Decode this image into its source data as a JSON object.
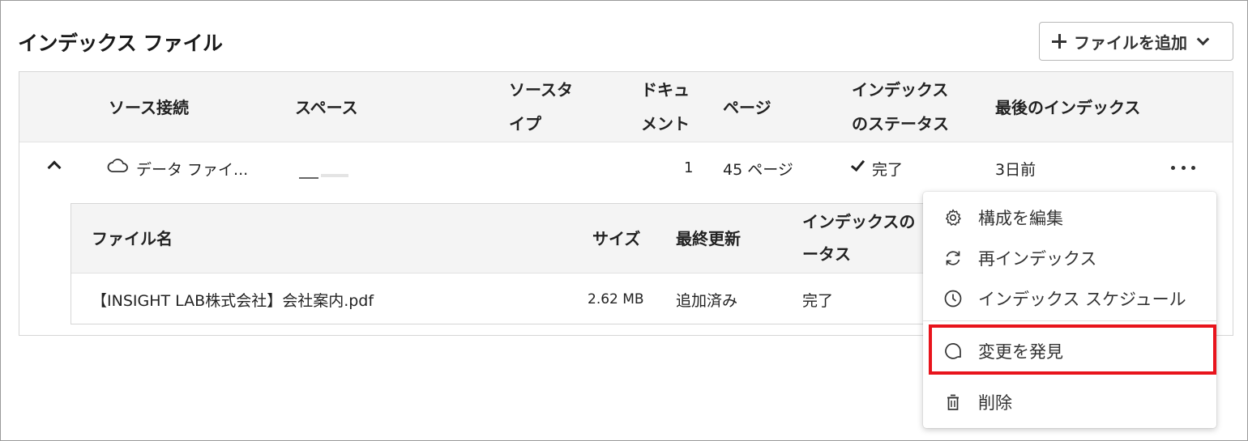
{
  "page": {
    "title": "インデックス ファイル",
    "add_button": "ファイルを追加"
  },
  "outer_table": {
    "headers": {
      "source": "ソース接続",
      "space": "スペース",
      "source_type_1": "ソースタ",
      "source_type_2": "イプ",
      "documents_1": "ドキュ",
      "documents_2": "メント",
      "pages": "ページ",
      "status_1": "インデックス",
      "status_2": "のステータス",
      "last_index": "最後のインデックス"
    },
    "row": {
      "source": "データ ファイ...",
      "documents": "1",
      "pages": "45 ページ",
      "status": "完了",
      "last_index": "3日前"
    }
  },
  "inner_table": {
    "headers": {
      "file_name": "ファイル名",
      "size": "サイズ",
      "last_updated": "最終更新",
      "status_1": "インデックスの",
      "status_2": "ータス"
    },
    "row": {
      "file_name": "【INSIGHT LAB株式会社】会社案内.pdf",
      "size": "2.62 MB",
      "last_updated": "追加済み",
      "status": "完了"
    }
  },
  "menu": {
    "items": [
      {
        "label": "構成を編集",
        "icon": "gear-icon"
      },
      {
        "label": "再インデックス",
        "icon": "refresh-icon"
      },
      {
        "label": "インデックス スケジュール",
        "icon": "clock-icon"
      },
      {
        "label": "変更を発見",
        "icon": "discover-icon"
      },
      {
        "label": "削除",
        "icon": "trash-icon"
      }
    ]
  },
  "colors": {
    "highlight": "#e8141c",
    "header_bg": "#f4f4f4"
  }
}
